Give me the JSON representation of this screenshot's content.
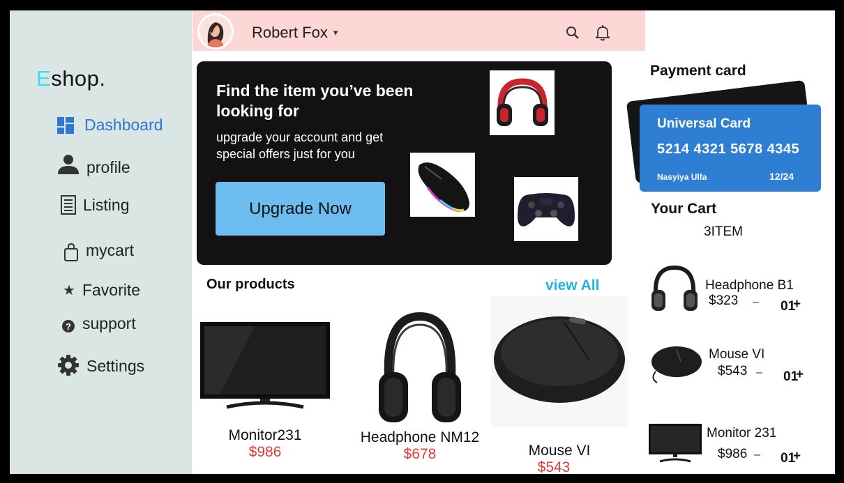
{
  "brand": {
    "logo_accent": "E",
    "logo_rest": "shop."
  },
  "sidebar": {
    "items": [
      {
        "label": "Dashboard",
        "icon": "dashboard-grid-icon"
      },
      {
        "label": "profile",
        "icon": "user-icon"
      },
      {
        "label": "Listing",
        "icon": "list-icon"
      },
      {
        "label": "mycart",
        "icon": "shopping-bag-icon"
      },
      {
        "label": "Favorite",
        "icon": "star-icon"
      },
      {
        "label": "support",
        "icon": "help-icon"
      },
      {
        "label": "Settings",
        "icon": "gear-icon"
      }
    ]
  },
  "header": {
    "user_name": "Robert Fox",
    "caret": "▾",
    "icons": [
      "search-icon",
      "bell-icon"
    ]
  },
  "promo": {
    "title": "Find the item you’ve been looking for",
    "subtitle": "upgrade your account and get special offers just for you",
    "button_label": "Upgrade Now"
  },
  "products": {
    "title": "Our products",
    "view_all": "view All",
    "items": [
      {
        "name": "Monitor231",
        "price": "$986"
      },
      {
        "name": "Headphone NM12",
        "price": "$678"
      },
      {
        "name": "Mouse VI",
        "price": "$543"
      }
    ]
  },
  "payment": {
    "title": "Payment card",
    "card_name": "Universal Card",
    "card_number": "5214 4321 5678 4345",
    "holder": "Nasyiya Ulfa",
    "expiry": "12/24"
  },
  "cart": {
    "title": "Your Cart",
    "count": "3ITEM",
    "items": [
      {
        "name": "Headphone B1",
        "price": "$323",
        "minus": "–",
        "qty": "01",
        "plus": "+"
      },
      {
        "name": "Mouse VI",
        "price": "$543",
        "minus": "–",
        "qty": "01",
        "plus": "+"
      },
      {
        "name": "Monitor 231",
        "price": "$986",
        "minus": "–",
        "qty": "01",
        "plus": "+"
      }
    ]
  },
  "colors": {
    "sidebar_bg": "#d9e6e3",
    "header_bg": "#fdd6d6",
    "accent_blue": "#2f78d0",
    "logo_accent": "#37e0f0",
    "promo_bg": "#141112",
    "upgrade_button": "#6cbcf0",
    "card_blue": "#2e7fd4",
    "price_red": "#e03a3a",
    "view_all": "#22b5e3"
  }
}
